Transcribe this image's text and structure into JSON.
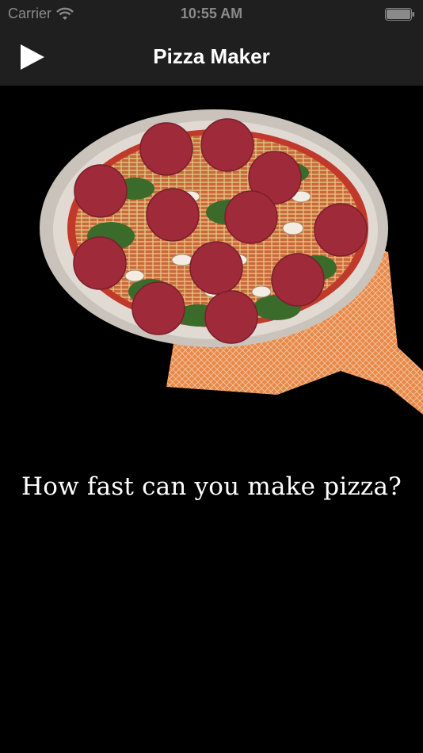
{
  "status_bar": {
    "carrier": "Carrier",
    "time": "10:55 AM",
    "wifi_icon": "wifi-icon",
    "battery_icon": "battery-icon"
  },
  "nav_bar": {
    "title": "Pizza Maker",
    "play_icon": "play-icon"
  },
  "main": {
    "image": "pizza-on-peel",
    "tagline": "How fast can you make pizza?"
  },
  "colors": {
    "bar_background": "#1f1f1f",
    "background": "#000000",
    "text": "#ffffff",
    "status_text": "#8a8a8a",
    "pepperoni": "#9e2a3a",
    "peel": "#e8894a"
  }
}
